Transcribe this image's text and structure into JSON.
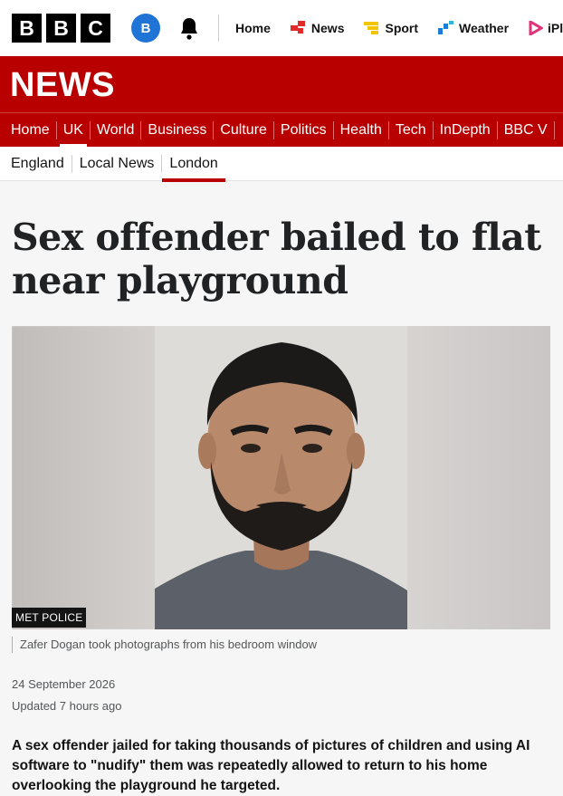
{
  "brand": {
    "logo_letters": [
      "B",
      "B",
      "C"
    ],
    "account_initial": "B",
    "news_wordmark": "NEWS"
  },
  "top_nav": [
    {
      "label": "Home",
      "icon": "none"
    },
    {
      "label": "News",
      "icon": "news-icon",
      "color": "#e32a2a"
    },
    {
      "label": "Sport",
      "icon": "sport-icon",
      "color": "#f3c400"
    },
    {
      "label": "Weather",
      "icon": "weather-icon",
      "color": "#1d7dd6"
    },
    {
      "label": "iPla",
      "icon": "iplayer-icon",
      "color": "#e2327a"
    }
  ],
  "section_nav": [
    "Home",
    "UK",
    "World",
    "Business",
    "Culture",
    "Politics",
    "Health",
    "Tech",
    "InDepth",
    "BBC V"
  ],
  "section_active": "UK",
  "sub_nav": [
    "England",
    "Local News",
    "London"
  ],
  "sub_active": "London",
  "article": {
    "headline": "Sex offender bailed to flat near playground",
    "image_credit": "MET POLICE",
    "image_caption": "Zafer Dogan took photographs from his bedroom window",
    "date": "24 September 2026",
    "updated": "Updated 7 hours ago",
    "lede": "A sex offender jailed for taking thousands of pictures of children and using AI software to \"nudify\" them was repeatedly allowed to return to his home overlooking the playground he targeted."
  },
  "colors": {
    "brand_red": "#b80000",
    "account_blue": "#1f74d6"
  }
}
